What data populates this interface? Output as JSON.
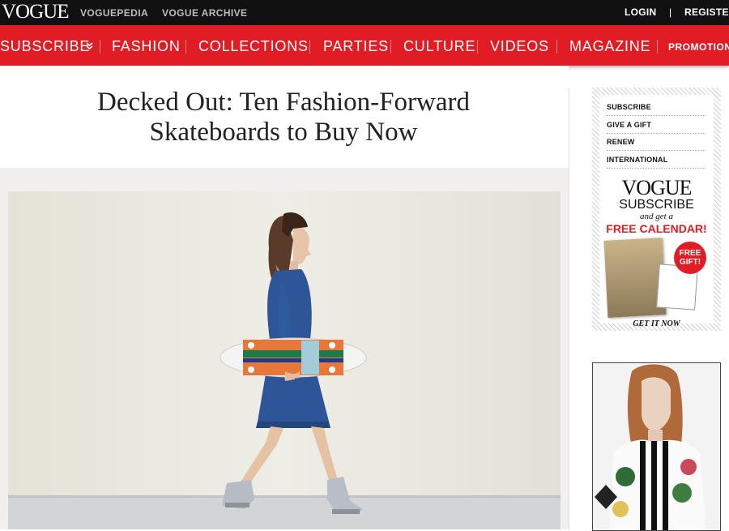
{
  "topbar": {
    "logo": "VOGUE",
    "links": [
      "VOGUEPEDIA",
      "VOGUE ARCHIVE"
    ],
    "login": "LOGIN",
    "separator": "|",
    "register": "REGISTER"
  },
  "nav": {
    "items": [
      "SUBSCRIBE",
      "FASHION",
      "COLLECTIONS",
      "PARTIES",
      "CULTURE",
      "VIDEOS",
      "MAGAZINE",
      "PROMOTIONS"
    ],
    "subscribe_icon": "double-chevron-down-icon"
  },
  "article": {
    "title": "Decked Out: Ten Fashion-Forward Skateboards to Buy Now"
  },
  "sidebar": {
    "links": [
      "SUBSCRIBE",
      "GIVE A GIFT",
      "RENEW",
      "INTERNATIONAL"
    ],
    "ad": {
      "logo": "VOGUE",
      "subscribe": "SUBSCRIBE",
      "and_get": "and get a",
      "offer": "FREE CALENDAR!",
      "badge": "FREE GIFT!",
      "cta": "GET IT NOW"
    }
  },
  "colors": {
    "brand_red": "#e21c24",
    "topbar": "#111111"
  }
}
